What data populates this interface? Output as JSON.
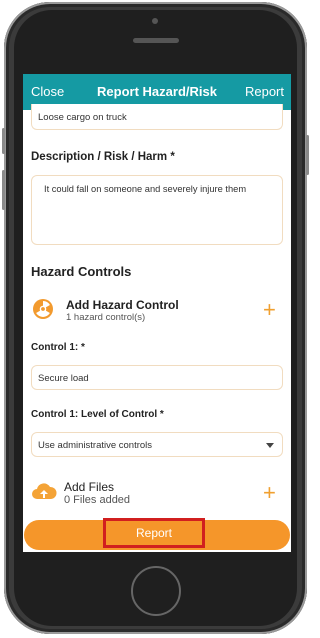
{
  "header": {
    "close_label": "Close",
    "title": "Report Hazard/Risk",
    "report_label": "Report",
    "bg_color": "#159aa3"
  },
  "form": {
    "title_value": "Loose cargo on truck",
    "description_label": "Description / Risk / Harm *",
    "description_value": "It could fall on someone and severely injure them",
    "hazard_controls_title": "Hazard Controls",
    "add_hazard_control": {
      "icon": "radiation-icon",
      "label": "Add Hazard Control",
      "count": "1 hazard control(s)"
    },
    "control1_label": "Control 1: *",
    "control1_value": "Secure load",
    "control1_level_label": "Control 1: Level of Control *",
    "control1_level_value": "Use administrative controls",
    "add_files": {
      "icon": "cloud-upload-icon",
      "label": "Add Files",
      "count": "0 Files added"
    }
  },
  "footer": {
    "report_button_label": "Report",
    "accent_color": "#f5962a",
    "highlight_color": "#d11f1f"
  }
}
